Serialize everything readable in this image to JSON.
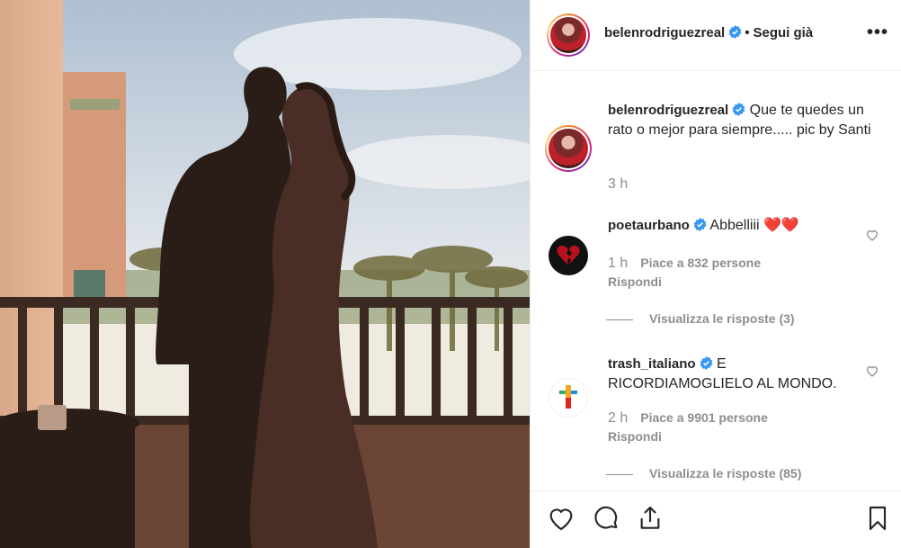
{
  "post": {
    "photo_alt": ""
  },
  "header": {
    "username": "belenrodriguezreal",
    "separator": "•",
    "follow_label": "Segui già",
    "more_label": "•••"
  },
  "caption": {
    "username": "belenrodriguezreal",
    "text": "Que te quedes un rato o mejor para siempre..... pic by Santi",
    "time": "3 h"
  },
  "comments": [
    {
      "username": "poetaurbano",
      "text": "Abbelliii ❤️❤️",
      "time": "1 h",
      "likes": "Piace a 832 persone",
      "reply_label": "Rispondi",
      "view_replies": "Visualizza le risposte (3)",
      "avatar_icon": "broken-heart-icon",
      "verified": true
    },
    {
      "username": "trash_italiano",
      "text": "E RICORDIAMOGLIELO AL MONDO.",
      "time": "2 h",
      "likes": "Piace a 9901 persone",
      "reply_label": "Rispondi",
      "view_replies": "Visualizza le risposte (85)",
      "avatar_icon": "tv-cross-logo-icon",
      "verified": true
    }
  ],
  "actions": {
    "icons": [
      "heart-icon",
      "comment-icon",
      "share-icon",
      "bookmark-icon"
    ]
  },
  "colors": {
    "verified_blue": "#3897f0",
    "secondary_text": "#8e8e8e",
    "border": "#efefef"
  }
}
